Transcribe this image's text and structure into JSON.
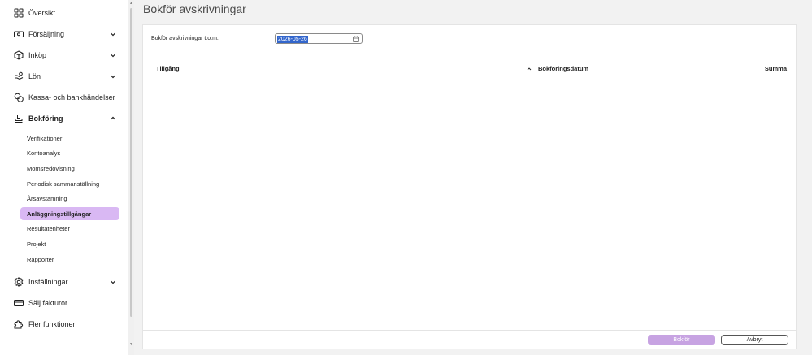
{
  "sidebar": {
    "items": [
      {
        "label": "Översikt",
        "icon": "grid-icon"
      },
      {
        "label": "Försäljning",
        "icon": "cash-icon"
      },
      {
        "label": "Inköp",
        "icon": "box-icon"
      },
      {
        "label": "Lön",
        "icon": "hand-money-icon"
      },
      {
        "label": "Kassa- och bankhändelser",
        "icon": "coins-icon"
      },
      {
        "label": "Bokföring",
        "icon": "stamp-icon"
      },
      {
        "label": "Inställningar",
        "icon": "gear-icon"
      },
      {
        "label": "Sälj fakturor",
        "icon": "card-icon"
      },
      {
        "label": "Fler funktioner",
        "icon": "puzzle-icon"
      }
    ],
    "sub_items": [
      "Verifikationer",
      "Kontoanalys",
      "Momsredovisning",
      "Periodisk sammanställning",
      "Årsavstämning",
      "Anläggningstillgångar",
      "Resultatenheter",
      "Projekt",
      "Rapporter"
    ],
    "active_sub_item": "Anläggningstillgångar"
  },
  "page": {
    "title": "Bokför avskrivningar"
  },
  "form": {
    "date_label": "Bokför avskrivningar t.o.m.",
    "date_value": "2026-05-26"
  },
  "table": {
    "columns": [
      "Tillgång",
      "Bokföringsdatum",
      "Summa"
    ],
    "rows": []
  },
  "actions": {
    "submit_label": "Bokför",
    "cancel_label": "Avbryt"
  },
  "colors": {
    "accent": "#d9b8f3",
    "button_disabled": "#c7a3e2"
  }
}
